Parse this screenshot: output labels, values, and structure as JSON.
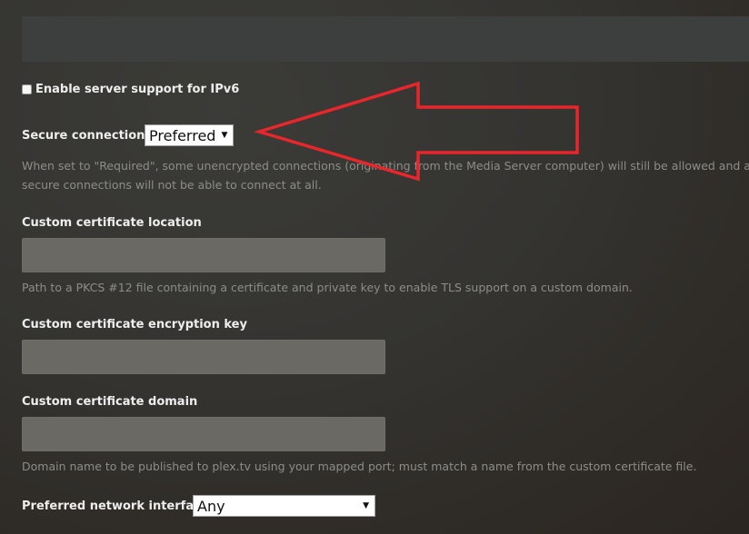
{
  "ipv6": {
    "label": "Enable server support for IPv6",
    "checked": false
  },
  "secure": {
    "label": "Secure connections",
    "selected": "Preferred",
    "help_line1": "When set to \"Required\", some unencrypted connections (originating from the Media Server computer) will still be allowed and ap",
    "help_line2": "secure connections will not be able to connect at all."
  },
  "cert_location": {
    "label": "Custom certificate location",
    "value": "",
    "help": "Path to a PKCS #12 file containing a certificate and private key to enable TLS support on a custom domain."
  },
  "cert_key": {
    "label": "Custom certificate encryption key",
    "value": ""
  },
  "cert_domain": {
    "label": "Custom certificate domain",
    "value": "",
    "help": "Domain name to be published to plex.tv using your mapped port; must match a name from the custom certificate file."
  },
  "network": {
    "label": "Preferred network interface",
    "selected": "Any"
  },
  "colors": {
    "annotation_arrow": "#e8262b",
    "input_bg": "#6a6964",
    "help_text": "#8d8d88"
  },
  "icons": {
    "dropdown": "triangle-down-icon",
    "annotation": "left-arrow-annotation"
  }
}
